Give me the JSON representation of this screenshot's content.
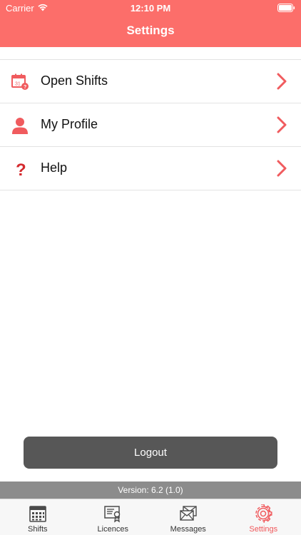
{
  "status_bar": {
    "carrier": "Carrier",
    "time": "12:10 PM"
  },
  "header": {
    "title": "Settings"
  },
  "menu": {
    "items": [
      {
        "label": "Open Shifts",
        "icon": "calendar-icon"
      },
      {
        "label": "My Profile",
        "icon": "person-icon"
      },
      {
        "label": "Help",
        "icon": "question-icon"
      }
    ]
  },
  "logout_label": "Logout",
  "version": "Version: 6.2 (1.0)",
  "tabs": [
    {
      "label": "Shifts",
      "icon": "calendar-grid-icon"
    },
    {
      "label": "Licences",
      "icon": "certificate-icon"
    },
    {
      "label": "Messages",
      "icon": "envelopes-icon"
    },
    {
      "label": "Settings",
      "icon": "gear-icon",
      "active": true
    }
  ],
  "colors": {
    "accent": "#fc6e6a",
    "logout": "#575757",
    "version_bar": "#8c8c8c",
    "chevron": "#f05b5e"
  }
}
